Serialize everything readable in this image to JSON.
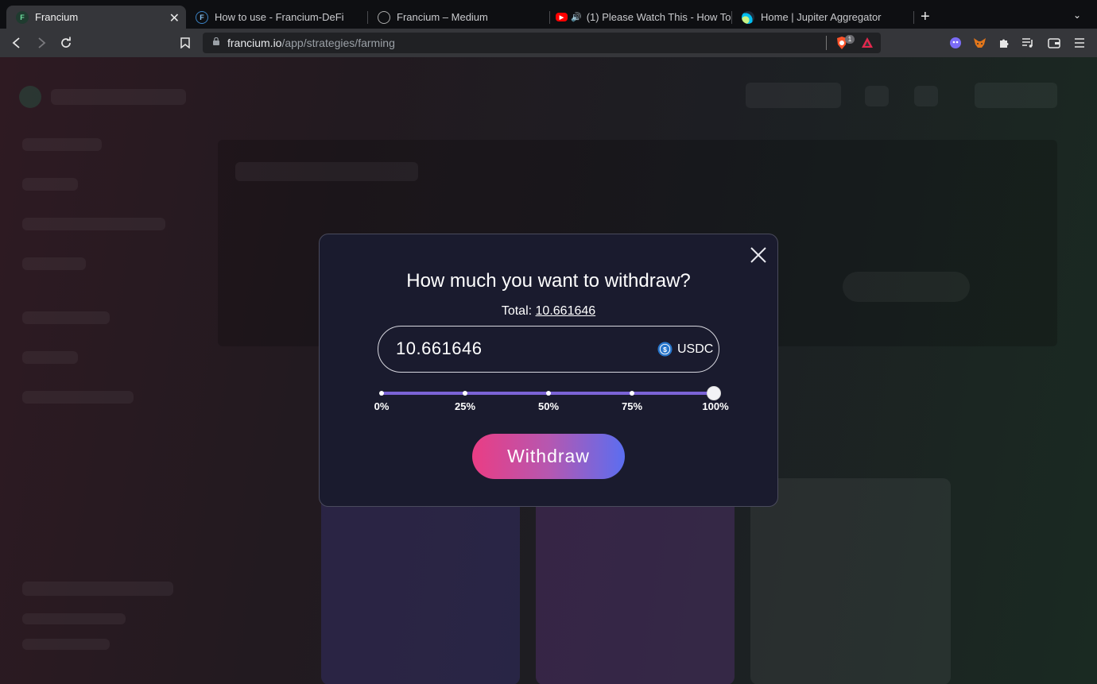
{
  "browser": {
    "tabs": [
      {
        "title": "Francium",
        "active": true
      },
      {
        "title": "How to use - Francium-DeFi",
        "active": false
      },
      {
        "title": "Francium – Medium",
        "active": false
      },
      {
        "title": "(1) Please Watch This - How To (",
        "active": false
      },
      {
        "title": "Home | Jupiter Aggregator",
        "active": false
      }
    ],
    "url_host": "francium.io",
    "url_path": "/app/strategies/farming",
    "extension_badge": "1"
  },
  "modal": {
    "title": "How much you want to withdraw?",
    "total_label": "Total:",
    "total_value": "10.661646",
    "amount": "10.661646",
    "token": "USDC",
    "slider": {
      "value_percent": 100,
      "stops": [
        "0%",
        "25%",
        "50%",
        "75%",
        "100%"
      ]
    },
    "withdraw_label": "Withdraw"
  },
  "colors": {
    "modal_bg": "#1a1b2e",
    "slider": "#7b63d6",
    "button_gradient_start": "#ea3d84",
    "button_gradient_end": "#5b6ef0",
    "usdc_blue": "#2775ca"
  }
}
